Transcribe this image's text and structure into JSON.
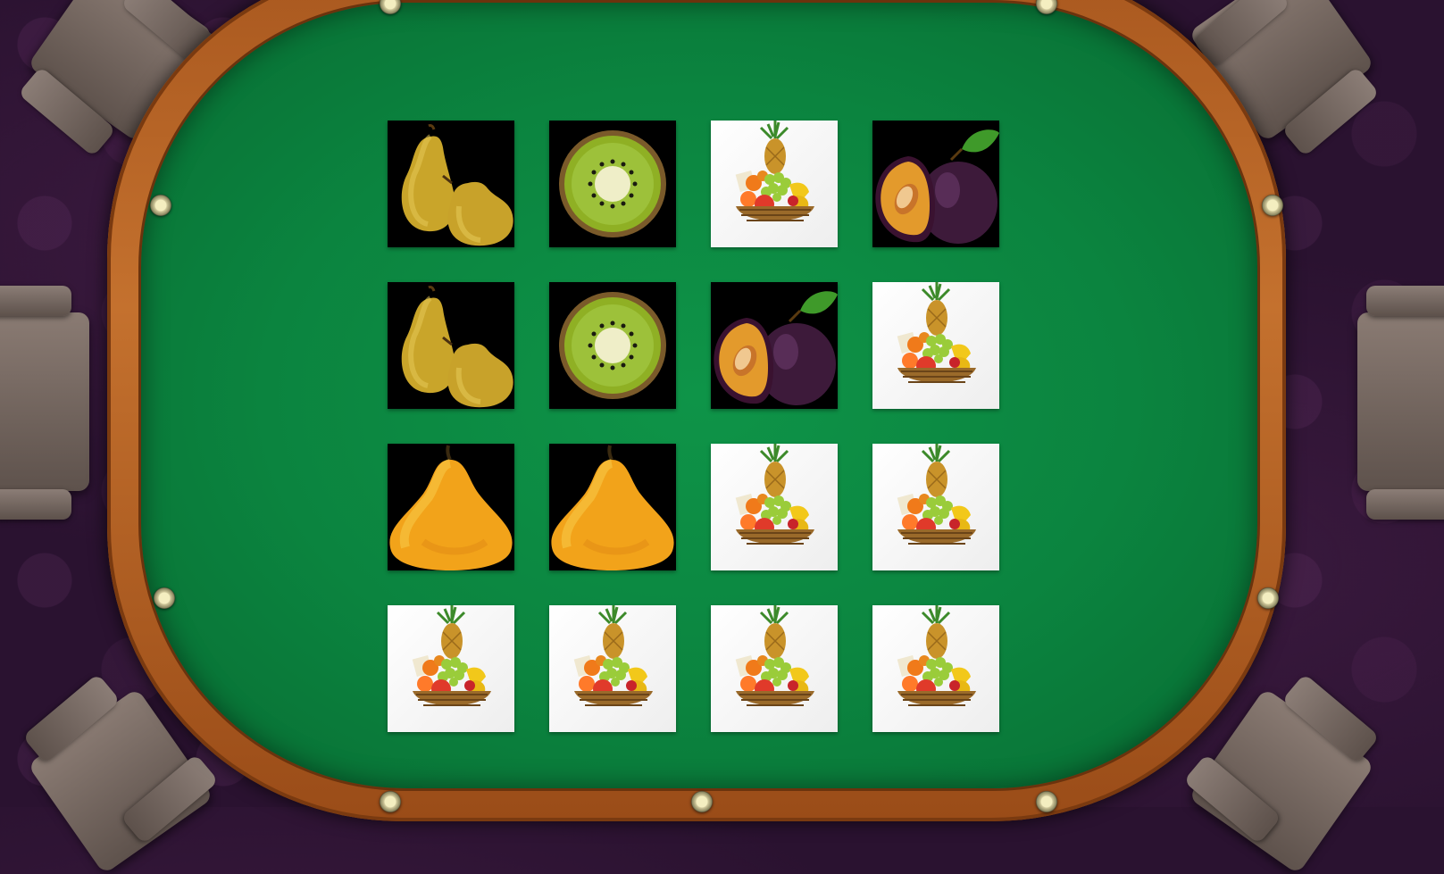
{
  "game": {
    "type": "memory-match",
    "theme": "fruits",
    "colors": {
      "felt": "#0b843f",
      "rail": "#c4712e",
      "room": "#2a1230",
      "card_back": "#ffffff",
      "card_face_bg": "#000000"
    }
  },
  "board": {
    "rows": 4,
    "cols": 4,
    "cards": [
      {
        "state": "revealed",
        "fruit": "pear-icon"
      },
      {
        "state": "revealed",
        "fruit": "kiwi-icon"
      },
      {
        "state": "hidden",
        "fruit": "fruit-basket-icon"
      },
      {
        "state": "revealed",
        "fruit": "plum-icon"
      },
      {
        "state": "revealed",
        "fruit": "pear-icon"
      },
      {
        "state": "revealed",
        "fruit": "kiwi-icon"
      },
      {
        "state": "revealed",
        "fruit": "plum-icon"
      },
      {
        "state": "hidden",
        "fruit": "fruit-basket-icon"
      },
      {
        "state": "revealed",
        "fruit": "mango-icon"
      },
      {
        "state": "revealed",
        "fruit": "mango-icon"
      },
      {
        "state": "hidden",
        "fruit": "fruit-basket-icon"
      },
      {
        "state": "hidden",
        "fruit": "fruit-basket-icon"
      },
      {
        "state": "hidden",
        "fruit": "fruit-basket-icon"
      },
      {
        "state": "hidden",
        "fruit": "fruit-basket-icon"
      },
      {
        "state": "hidden",
        "fruit": "fruit-basket-icon"
      },
      {
        "state": "hidden",
        "fruit": "fruit-basket-icon"
      }
    ]
  }
}
